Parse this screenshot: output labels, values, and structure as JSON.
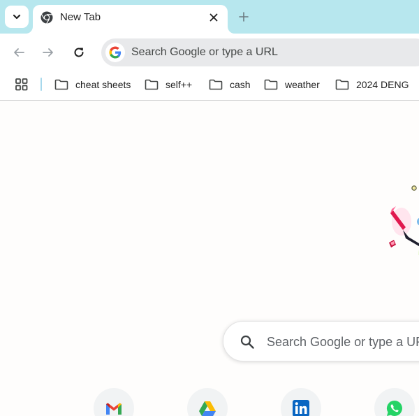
{
  "tabstrip": {
    "tab_search_icon": "chevron-down-icon",
    "tab": {
      "title": "New Tab",
      "favicon": "chrome-icon",
      "close_icon": "close-icon"
    },
    "new_tab_icon": "plus-icon"
  },
  "toolbar": {
    "back_icon": "arrow-left-icon",
    "forward_icon": "arrow-right-icon",
    "reload_icon": "reload-icon",
    "omnibox": {
      "placeholder": "Search Google or type a URL",
      "icon": "google-g-icon"
    }
  },
  "bookmarks": {
    "apps_icon": "apps-grid-icon",
    "items": [
      {
        "label": "cheat sheets",
        "icon": "folder-icon"
      },
      {
        "label": "self++",
        "icon": "folder-icon"
      },
      {
        "label": "cash",
        "icon": "folder-icon"
      },
      {
        "label": "weather",
        "icon": "folder-icon"
      },
      {
        "label": "2024 DENG",
        "icon": "folder-icon"
      }
    ]
  },
  "ntp": {
    "search_placeholder": "Search Google or type a URL",
    "shortcuts": [
      {
        "icon": "gmail-icon"
      },
      {
        "icon": "google-drive-icon"
      },
      {
        "icon": "linkedin-icon"
      },
      {
        "icon": "whatsapp-icon"
      }
    ]
  },
  "colors": {
    "tabstrip_bg": "#b7e7ee",
    "omnibox_bg": "#e8e9eb",
    "page_bg": "#fefdfc",
    "text": "#1f1f1f"
  }
}
